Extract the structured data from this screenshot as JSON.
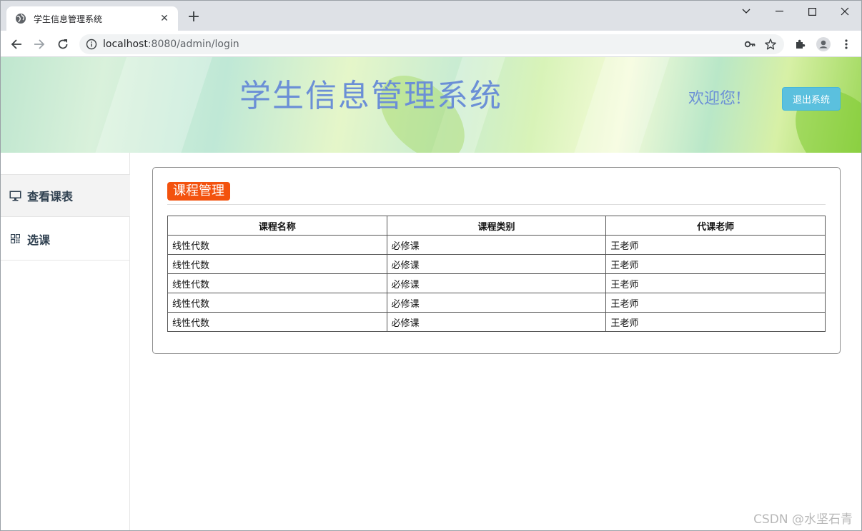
{
  "browser": {
    "tab_title": "学生信息管理系统",
    "url_host": "localhost",
    "url_path": ":8080/admin/login"
  },
  "header": {
    "title": "学生信息管理系统",
    "welcome": "欢迎您!",
    "logout_label": "退出系统"
  },
  "sidebar": {
    "items": [
      {
        "label": "查看课表",
        "icon": "monitor-icon"
      },
      {
        "label": "选课",
        "icon": "grid-icon"
      }
    ]
  },
  "panel": {
    "title": "课程管理",
    "columns": [
      "课程名称",
      "课程类别",
      "代课老师"
    ],
    "rows": [
      [
        "线性代数",
        "必修课",
        "王老师"
      ],
      [
        "线性代数",
        "必修课",
        "王老师"
      ],
      [
        "线性代数",
        "必修课",
        "王老师"
      ],
      [
        "线性代数",
        "必修课",
        "王老师"
      ],
      [
        "线性代数",
        "必修课",
        "王老师"
      ]
    ]
  },
  "watermark": "CSDN @水坚石青",
  "colors": {
    "title_blue": "#6b8fd6",
    "badge_orange": "#f3520e",
    "button_cyan": "#5bc0de"
  }
}
